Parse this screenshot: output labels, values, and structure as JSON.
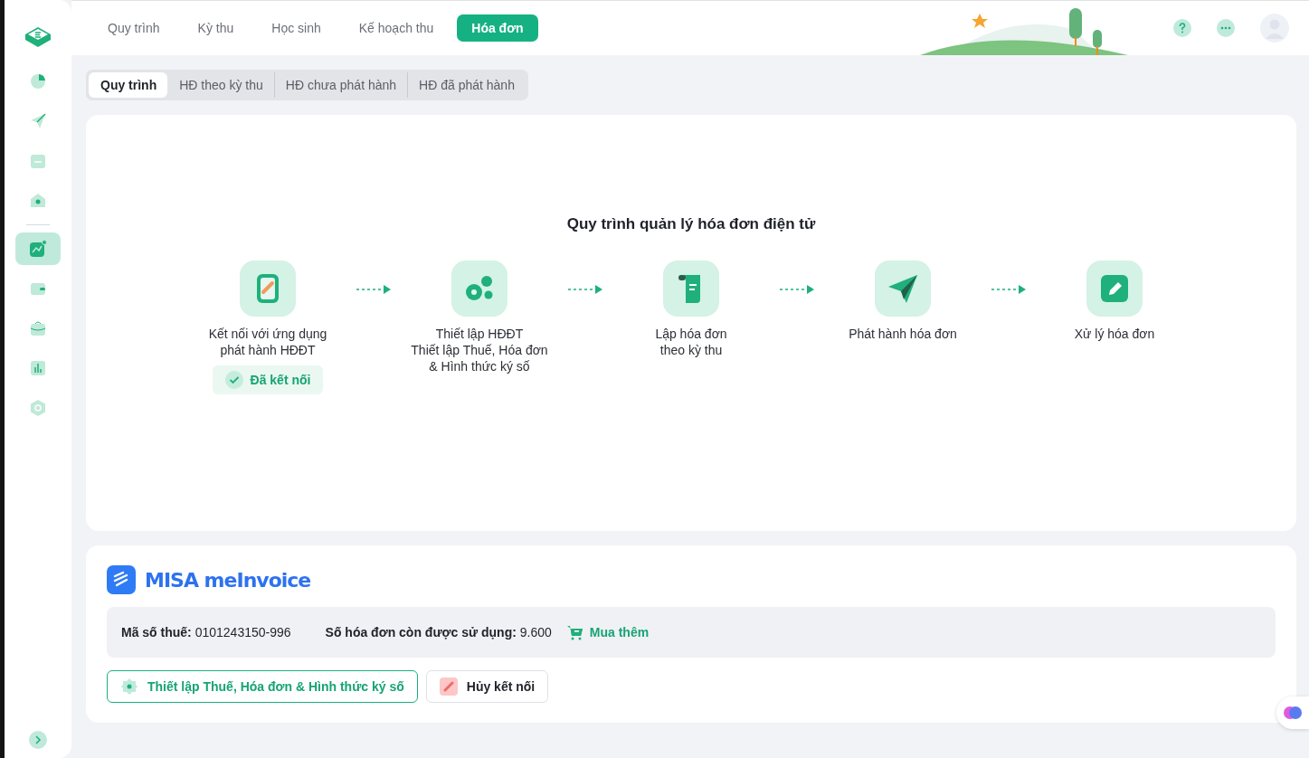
{
  "sidebar": {
    "items": [
      {
        "kind": "pie",
        "selected": false
      },
      {
        "kind": "plane",
        "selected": false
      },
      {
        "kind": "folder",
        "selected": false
      },
      {
        "kind": "house",
        "selected": false
      },
      {
        "kind": "trend",
        "selected": true
      },
      {
        "kind": "wallet",
        "selected": false
      },
      {
        "kind": "briefcase",
        "selected": false
      },
      {
        "kind": "bars",
        "selected": false
      },
      {
        "kind": "hexagon",
        "selected": false
      }
    ]
  },
  "top_tabs": [
    {
      "label": "Quy trình",
      "selected": false
    },
    {
      "label": "Kỳ thu",
      "selected": false
    },
    {
      "label": "Học sinh",
      "selected": false
    },
    {
      "label": "Kế hoạch thu",
      "selected": false
    },
    {
      "label": "Hóa đơn",
      "selected": true
    }
  ],
  "sub_tabs": [
    {
      "label": "Quy trình",
      "selected": true
    },
    {
      "label": "HĐ theo kỳ thu",
      "selected": false
    },
    {
      "label": "HĐ chưa phát hành",
      "selected": false
    },
    {
      "label": "HĐ đã phát hành",
      "selected": false
    }
  ],
  "process": {
    "title": "Quy trình quản lý hóa đơn điện tử",
    "steps": [
      {
        "kind": "link",
        "label": "Kết nối với ứng dụng\nphát hành HĐĐT",
        "status": "Đã kết nối"
      },
      {
        "kind": "gears",
        "label": "Thiết lập HĐĐT\nThiết lập Thuế, Hóa đơn\n& Hình thức ký số"
      },
      {
        "kind": "scroll",
        "label": "Lập hóa đơn\ntheo kỳ thu"
      },
      {
        "kind": "plane",
        "label": "Phát hành hóa đơn"
      },
      {
        "kind": "edit",
        "label": "Xử lý hóa đơn"
      }
    ]
  },
  "provider": {
    "logo_text": "MISA meInvoice",
    "tax_code_label": "Mã số thuế:",
    "tax_code": "0101243150-996",
    "remaining_label": "Số hóa đơn còn được sử dụng:",
    "remaining": "9.600",
    "buy_more": "Mua thêm",
    "buttons": [
      {
        "kind": "settings",
        "label": "Thiết lập Thuế, Hóa đơn & Hình thức ký số"
      },
      {
        "kind": "disconnect",
        "label": "Hủy kết nối"
      }
    ]
  }
}
